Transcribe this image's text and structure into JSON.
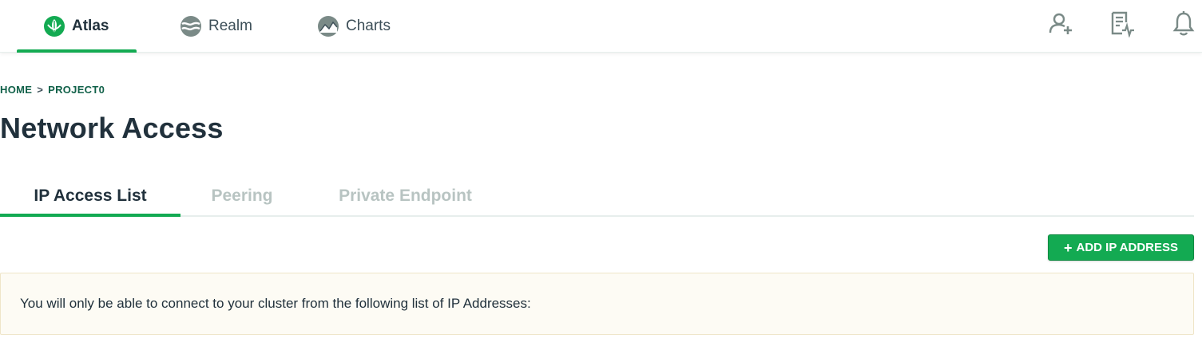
{
  "topnav": {
    "products": [
      {
        "label": "Atlas",
        "icon": "leaf-icon",
        "active": true
      },
      {
        "label": "Realm",
        "icon": "realm-icon",
        "active": false
      },
      {
        "label": "Charts",
        "icon": "charts-icon",
        "active": false
      }
    ],
    "actions": [
      {
        "icon": "invite-user-icon"
      },
      {
        "icon": "activity-feed-icon"
      },
      {
        "icon": "bell-icon"
      }
    ],
    "accent_color": "#13aa52"
  },
  "breadcrumb": {
    "home": "HOME",
    "separator": ">",
    "project": "PROJECT0"
  },
  "page": {
    "title": "Network Access"
  },
  "tabs": [
    {
      "label": "IP Access List",
      "active": true
    },
    {
      "label": "Peering",
      "active": false
    },
    {
      "label": "Private Endpoint",
      "active": false
    }
  ],
  "toolbar": {
    "add_ip_icon": "+",
    "add_ip_label": "ADD IP ADDRESS"
  },
  "notice": {
    "text": "You will only be able to connect to your cluster from the following list of IP Addresses:"
  }
}
